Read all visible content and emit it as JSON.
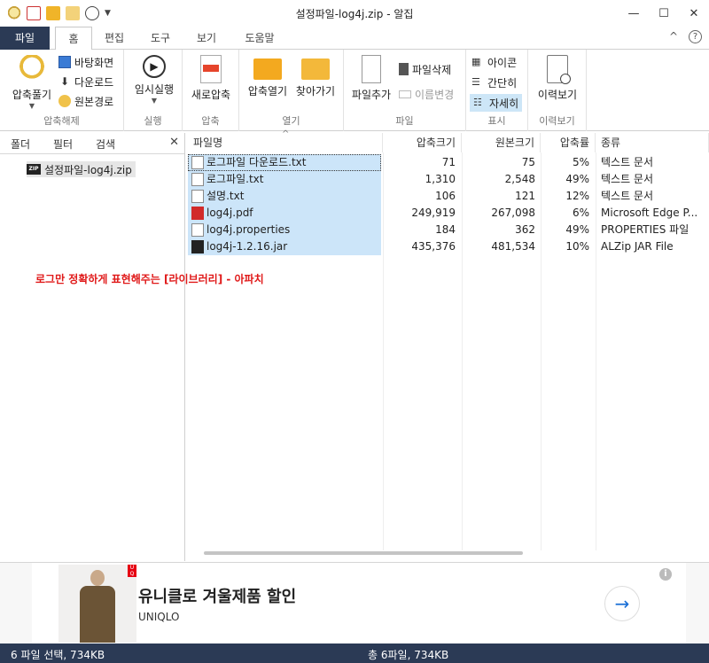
{
  "window": {
    "title": "설정파일-log4j.zip - 알집",
    "minimize_glyph": "—",
    "maximize_glyph": "☐",
    "close_glyph": "✕"
  },
  "ribbon_tabs": {
    "file": "파일",
    "home": "홈",
    "edit": "편집",
    "tools": "도구",
    "view": "보기",
    "help": "도움말"
  },
  "ribbon_right": {
    "collapse_glyph": "^",
    "help_glyph": "?"
  },
  "ribbon": {
    "extract_group": {
      "label": "압축해제",
      "extract_button": "압축풀기",
      "desktop": "바탕화면",
      "downloads": "다운로드",
      "original_path": "원본경로"
    },
    "run_group": {
      "label": "실행",
      "temp_run": "임시실행"
    },
    "compress_group": {
      "label": "압축",
      "new_compress": "새로압축"
    },
    "open_group": {
      "label": "열기",
      "open_archive": "압축열기",
      "find": "찾아가기"
    },
    "file_group": {
      "label": "파일",
      "add_file": "파일추가",
      "delete_file": "파일삭제",
      "rename": "이름변경"
    },
    "view_group": {
      "label": "표시",
      "icons": "아이콘",
      "simple": "간단히",
      "details": "자세히"
    },
    "history_group": {
      "label": "이력보기",
      "history": "이력보기"
    }
  },
  "left_pane": {
    "tabs": {
      "folder": "폴더",
      "filter": "필터",
      "search": "검색"
    },
    "close_glyph": "✕",
    "tree_item": "설정파일-log4j.zip"
  },
  "file_list": {
    "columns": {
      "name": "파일명",
      "compressed": "압축크기",
      "original": "원본크기",
      "ratio": "압축률",
      "type": "종류"
    },
    "rows": [
      {
        "name": "로그파일 다운로드.txt",
        "compressed": "71",
        "original": "75",
        "ratio": "5%",
        "type": "텍스트 문서",
        "icon": "txt"
      },
      {
        "name": "로그파일.txt",
        "compressed": "1,310",
        "original": "2,548",
        "ratio": "49%",
        "type": "텍스트 문서",
        "icon": "txt"
      },
      {
        "name": "설명.txt",
        "compressed": "106",
        "original": "121",
        "ratio": "12%",
        "type": "텍스트 문서",
        "icon": "txt"
      },
      {
        "name": "log4j.pdf",
        "compressed": "249,919",
        "original": "267,098",
        "ratio": "6%",
        "type": "Microsoft Edge P...",
        "icon": "pdf"
      },
      {
        "name": "log4j.properties",
        "compressed": "184",
        "original": "362",
        "ratio": "49%",
        "type": "PROPERTIES 파일",
        "icon": "blank"
      },
      {
        "name": "log4j-1.2.16.jar",
        "compressed": "435,376",
        "original": "481,534",
        "ratio": "10%",
        "type": "ALZip JAR File",
        "icon": "jar"
      }
    ]
  },
  "annotation": "로그만 정확하게 표현해주는 [라이브러리]  - 아파치",
  "ad": {
    "title": "유니클로 겨울제품 할인",
    "brand": "UNIQLO",
    "arrow_glyph": "→",
    "info_glyph": "i"
  },
  "status": {
    "left": "6 파일 선택,  734KB",
    "center": "총 6파일,  734KB"
  },
  "colors": {
    "navy": "#2b3a55",
    "selection": "#cce5f9",
    "annotation_red": "#e01919"
  }
}
